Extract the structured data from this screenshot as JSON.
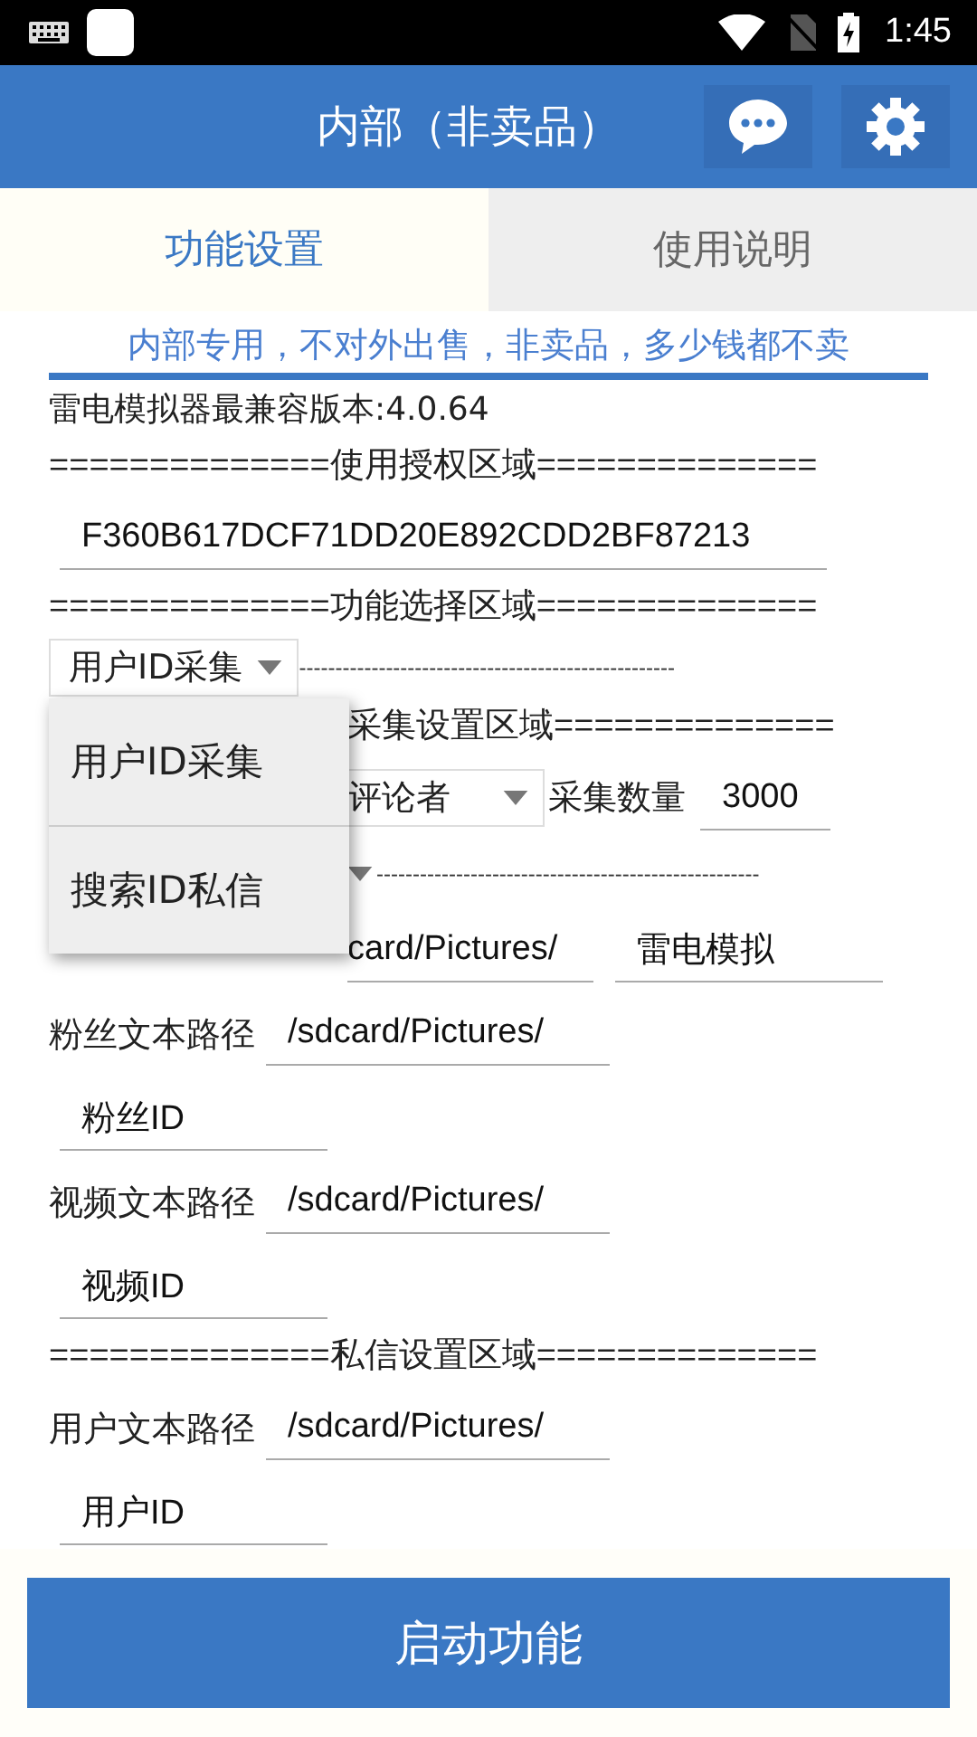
{
  "status_bar": {
    "time": "1:45"
  },
  "app_bar": {
    "title": "内部（非卖品）"
  },
  "tabs": [
    {
      "label": "功能设置",
      "selected": true
    },
    {
      "label": "使用说明",
      "selected": false
    }
  ],
  "notice": "内部专用，不对外出售，非卖品，多少钱都不卖",
  "rows": [
    {
      "kind": "text",
      "text": "雷电模拟器最兼容版本:4.0.64"
    },
    {
      "kind": "section",
      "text": "==============使用授权区域=============="
    },
    {
      "kind": "license_field",
      "value": "F360B617DCF71DD20E892CDD2BF87213"
    },
    {
      "kind": "section",
      "text": "==============功能选择区域=============="
    },
    {
      "kind": "spinner",
      "value": "用户ID采集",
      "dashes": "----------------------------------------------------"
    }
  ],
  "menu_rows": [
    {
      "kind": "section",
      "text": "采集设置区域=============="
    },
    {
      "kind": "spinner_count",
      "value": "评论者",
      "label": "采集数量",
      "count": "3000"
    },
    {
      "kind": "caret_dashes",
      "dashes": "-----------------------------------------------------"
    },
    {
      "kind": "double_field",
      "value": "card/Pictures/",
      "value2": "雷电模拟"
    }
  ],
  "rows2": [
    {
      "kind": "label_field",
      "label": "粉丝文本路径",
      "value": "/sdcard/Pictures/"
    },
    {
      "kind": "field",
      "value": "粉丝ID"
    },
    {
      "kind": "label_field",
      "label": "视频文本路径",
      "value": "/sdcard/Pictures/"
    },
    {
      "kind": "field",
      "value": "视频ID"
    },
    {
      "kind": "section",
      "text": "==============私信设置区域=============="
    },
    {
      "kind": "label_field",
      "label": "用户文本路径",
      "value": "/sdcard/Pictures/"
    },
    {
      "kind": "field",
      "value": "用户ID"
    }
  ],
  "dropdown_menu": [
    {
      "label": "用户ID采集"
    },
    {
      "label": "搜索ID私信"
    }
  ],
  "start_button": "启动功能"
}
